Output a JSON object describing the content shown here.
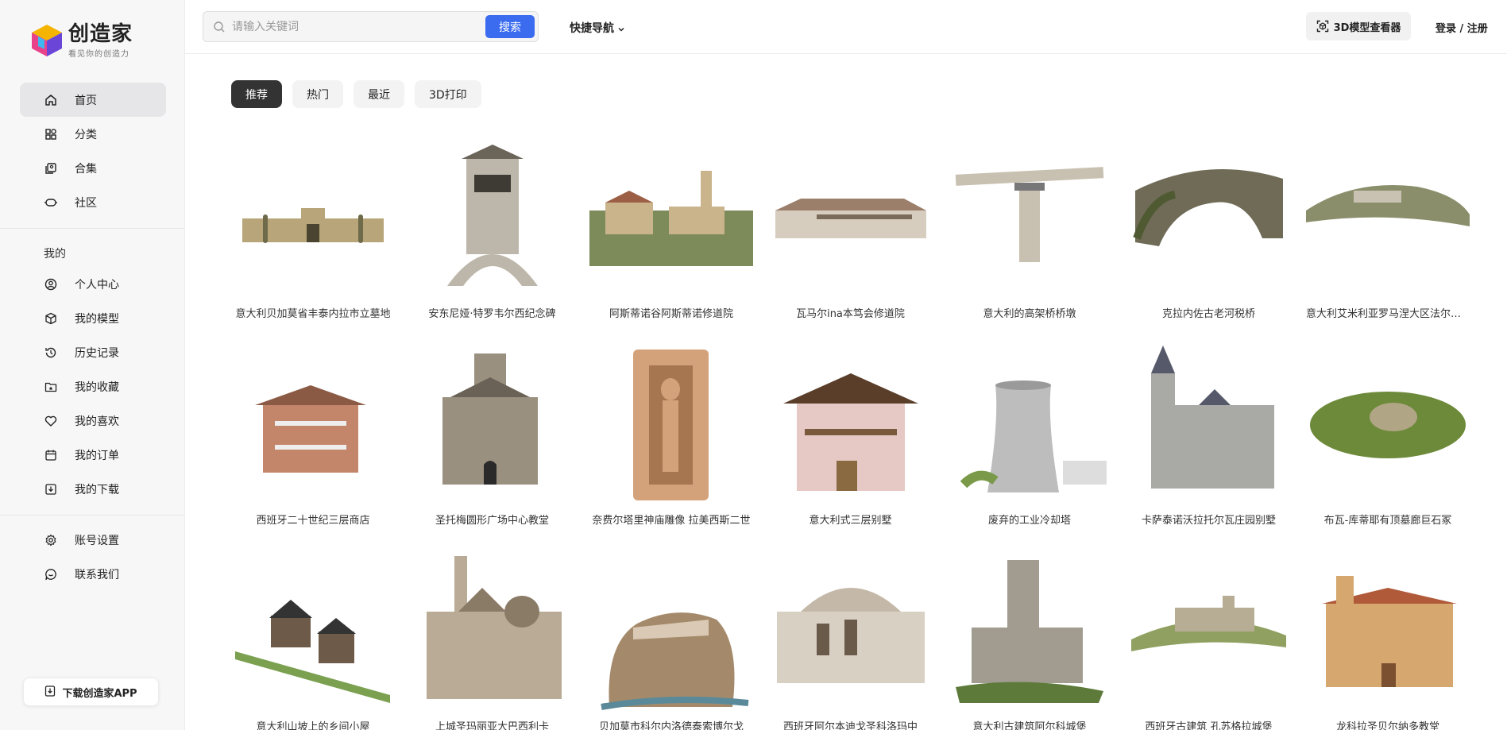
{
  "brand": {
    "name": "创造家",
    "tagline": "看见你的创造力"
  },
  "sidebar": {
    "main": [
      {
        "label": "首页",
        "icon": "home-icon",
        "active": true
      },
      {
        "label": "分类",
        "icon": "category-icon"
      },
      {
        "label": "合集",
        "icon": "collection-icon"
      },
      {
        "label": "社区",
        "icon": "community-icon"
      }
    ],
    "mine_title": "我的",
    "mine": [
      {
        "label": "个人中心",
        "icon": "user-icon"
      },
      {
        "label": "我的模型",
        "icon": "cube-icon"
      },
      {
        "label": "历史记录",
        "icon": "history-icon"
      },
      {
        "label": "我的收藏",
        "icon": "folder-star-icon"
      },
      {
        "label": "我的喜欢",
        "icon": "heart-icon"
      },
      {
        "label": "我的订单",
        "icon": "order-icon"
      },
      {
        "label": "我的下载",
        "icon": "download-icon"
      }
    ],
    "settings": [
      {
        "label": "账号设置",
        "icon": "gear-icon"
      },
      {
        "label": "联系我们",
        "icon": "chat-icon"
      }
    ],
    "download_app": "下载创造家APP"
  },
  "header": {
    "search_placeholder": "请输入关键词",
    "search_button": "搜索",
    "quick_nav": "快捷导航",
    "viewer": "3D模型查看器",
    "login": "登录 / 注册"
  },
  "tabs": [
    {
      "label": "推荐",
      "active": true
    },
    {
      "label": "热门"
    },
    {
      "label": "最近"
    },
    {
      "label": "3D打印"
    }
  ],
  "models": [
    {
      "title": "意大利贝加莫省丰泰内拉市立墓地",
      "kind": "wall",
      "colors": [
        "#b8a57a",
        "#6e6a4a"
      ]
    },
    {
      "title": "安东尼娅·特罗韦尔西纪念碑",
      "kind": "monument",
      "colors": [
        "#bdb7ab",
        "#6b6459"
      ]
    },
    {
      "title": "阿斯蒂诺谷阿斯蒂诺修道院",
      "kind": "village",
      "colors": [
        "#c9b48c",
        "#7d8a5a"
      ]
    },
    {
      "title": "瓦马尔ina本笃会修道院",
      "kind": "longhouse",
      "colors": [
        "#d7cdbf",
        "#9c7f6a"
      ]
    },
    {
      "title": "意大利的高架桥桥墩",
      "kind": "pier",
      "colors": [
        "#c8c0b0",
        "#777"
      ]
    },
    {
      "title": "克拉内佐古老河税桥",
      "kind": "arch",
      "colors": [
        "#6f6b56",
        "#4f5a33"
      ]
    },
    {
      "title": "意大利艾米利亚罗马涅大区法尔内托",
      "kind": "hilltown",
      "colors": [
        "#8b8e6b",
        "#c9c2b3"
      ]
    },
    {
      "title": "西班牙二十世纪三层商店",
      "kind": "villa",
      "colors": [
        "#c4866b",
        "#8b5a45"
      ]
    },
    {
      "title": "圣托梅圆形广场中心教堂",
      "kind": "rotunda",
      "colors": [
        "#9a9080",
        "#6a6256"
      ]
    },
    {
      "title": "奈费尔塔里神庙雕像 拉美西斯二世",
      "kind": "statue",
      "colors": [
        "#d4a27a",
        "#a67650"
      ]
    },
    {
      "title": "意大利式三层别墅",
      "kind": "chalet",
      "colors": [
        "#e6c9c4",
        "#7a5a3c"
      ]
    },
    {
      "title": "废弃的工业冷却塔",
      "kind": "tower",
      "colors": [
        "#bdbdbd",
        "#7a9a4a"
      ]
    },
    {
      "title": "卡萨泰诺沃拉托尔瓦庄园别墅",
      "kind": "castle",
      "colors": [
        "#a9a9a5",
        "#55596a"
      ]
    },
    {
      "title": "布瓦-库蒂耶有顶墓廊巨石冢",
      "kind": "mound",
      "colors": [
        "#6d8a3a",
        "#b0a585"
      ]
    },
    {
      "title": "意大利山坡上的乡间小屋",
      "kind": "cabins",
      "colors": [
        "#7aa050",
        "#6e5a48"
      ]
    },
    {
      "title": "上城圣玛丽亚大巴西利卡",
      "kind": "cathedral",
      "colors": [
        "#b9ab95",
        "#8a7b66"
      ]
    },
    {
      "title": "贝加莫市科尔内洛德泰索博尔戈",
      "kind": "cliff",
      "colors": [
        "#a48a6a",
        "#5f6a3a"
      ]
    },
    {
      "title": "西班牙阿尔本迪戈圣科洛玛中",
      "kind": "church",
      "colors": [
        "#d9d0c4",
        "#9a8877"
      ]
    },
    {
      "title": "意大利古建筑阿尔科城堡",
      "kind": "ruin",
      "colors": [
        "#a29c90",
        "#5d7a3a"
      ]
    },
    {
      "title": "西班牙古建筑 孔苏格拉城堡",
      "kind": "fort",
      "colors": [
        "#b7ad95",
        "#8fa060"
      ]
    },
    {
      "title": "龙科拉圣贝尔纳多教堂",
      "kind": "chapel",
      "colors": [
        "#d6a86f",
        "#b05a3a"
      ]
    }
  ]
}
